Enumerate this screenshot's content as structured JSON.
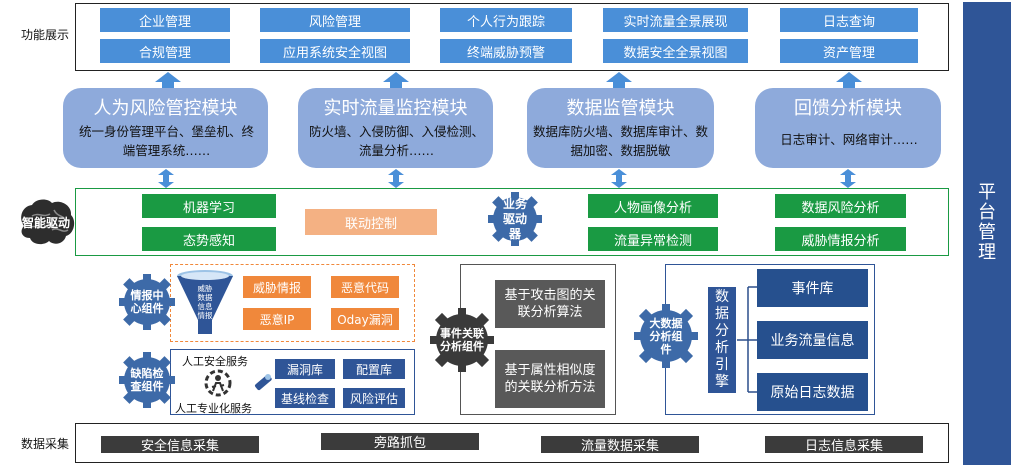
{
  "sections": {
    "function_display": "功能展示",
    "data_collection": "数据采集",
    "platform_management": "平台管理"
  },
  "functions": [
    {
      "top": "企业管理",
      "bottom": "合规管理"
    },
    {
      "top": "风险管理",
      "bottom": "应用系统安全视图"
    },
    {
      "top": "个人行为跟踪",
      "bottom": "终端威胁预警"
    },
    {
      "top": "实时流量全景展现",
      "bottom": "数据安全全景视图"
    },
    {
      "top": "日志查询",
      "bottom": "资产管理"
    }
  ],
  "modules": [
    {
      "title": "人为风险管控模块",
      "desc": "统一身份管理平台、堡垒机、终端管理系统……"
    },
    {
      "title": "实时流量监控模块",
      "desc": "防火墙、入侵防御、入侵检测、流量分析……"
    },
    {
      "title": "数据监管模块",
      "desc": "数据库防火墙、数据库审计、数据加密、数据脱敏"
    },
    {
      "title": "回馈分析模块",
      "desc": "日志审计、网络审计……"
    }
  ],
  "engine": {
    "brain_label": "智能驱动",
    "machine_learning": "机器学习",
    "situation_awareness": "态势感知",
    "linkage_control": "联动控制",
    "business_driver": "业务驱动器",
    "persona_analysis": "人物画像分析",
    "traffic_anomaly": "流量异常检测",
    "data_risk_analysis": "数据风险分析",
    "threat_intel_analysis": "威胁情报分析"
  },
  "intel_center": {
    "gear_label": "情报中心组件",
    "funnel_label": "威胁数据信息情报",
    "items": [
      "威胁情报",
      "恶意代码",
      "恶意IP",
      "Oday漏洞"
    ]
  },
  "defect_check": {
    "gear_label": "缺陷检查组件",
    "manual_service": "人工安全服务",
    "professional_service": "人工专业化服务",
    "items": [
      "漏洞库",
      "配置库",
      "基线检查",
      "风险评估"
    ]
  },
  "event_correlation": {
    "gear_label": "事件关联分析组件",
    "methods": [
      "基于攻击图的关联分析算法",
      "基于属性相似度的关联分析方法"
    ]
  },
  "bigdata": {
    "gear_label": "大数据分析组件",
    "engine_label": "数据分析引擎",
    "stores": [
      "事件库",
      "业务流量信息",
      "原始日志数据"
    ]
  },
  "collection": [
    "安全信息采集",
    "旁路抓包",
    "流量数据采集",
    "日志信息采集"
  ],
  "colors": {
    "blue": "#4a8fd8",
    "module": "#8eaadb",
    "green": "#1a9a43",
    "orange": "#f0883b",
    "navy": "#26508e",
    "gear": "#3d6aa8"
  }
}
